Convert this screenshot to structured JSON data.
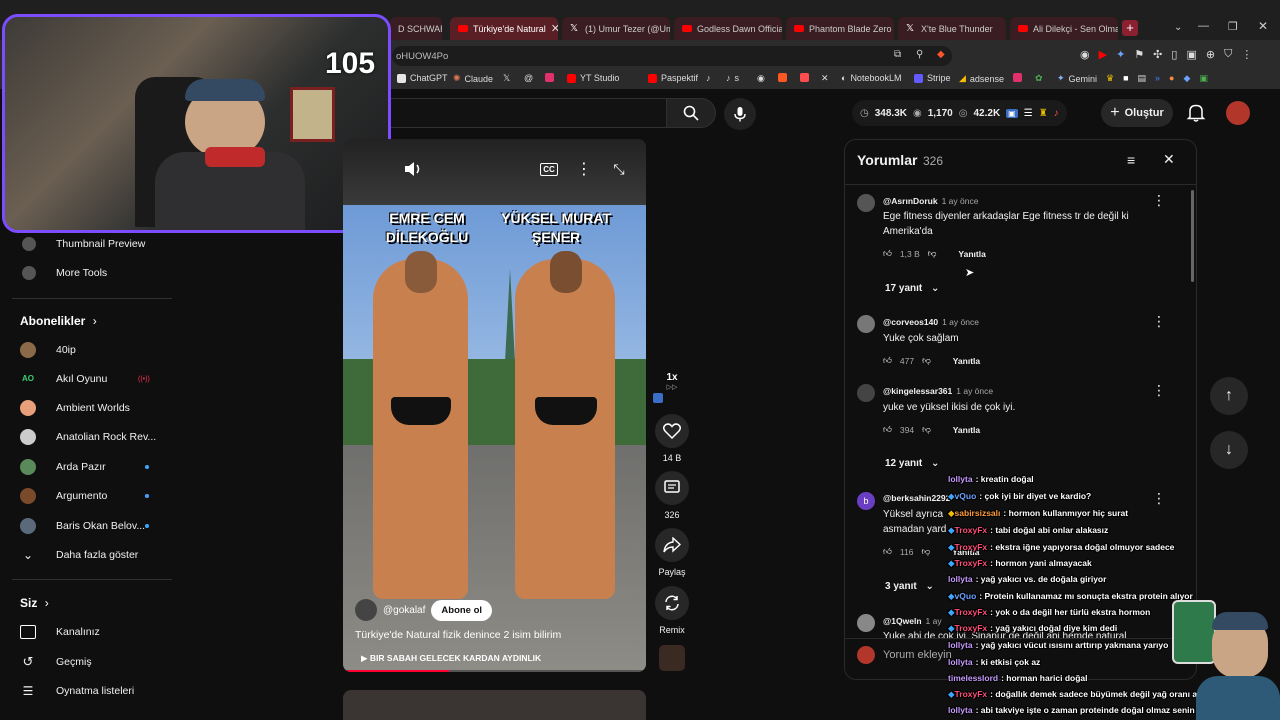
{
  "webcam": {
    "viewer_count": "105"
  },
  "tabs": [
    {
      "label": "D SCHWARZE",
      "icon": "none",
      "active": false
    },
    {
      "label": "Türkiye'de Natural",
      "icon": "youtube",
      "active": true
    },
    {
      "label": "(1) Umur Tezer (@Um",
      "icon": "x",
      "active": false
    },
    {
      "label": "Godless Dawn Officia",
      "icon": "youtube",
      "active": false
    },
    {
      "label": "Phantom Blade Zero",
      "icon": "youtube",
      "active": false
    },
    {
      "label": "X'te Blue Thunder",
      "icon": "x",
      "active": false
    },
    {
      "label": "Ali Dilekçi - Sen Olma",
      "icon": "youtube",
      "active": false
    }
  ],
  "address": {
    "url_fragment": "oHUOW4Po"
  },
  "bookmarks": [
    {
      "label": "ChatGPT",
      "color": "#e6e6e6"
    },
    {
      "label": "Claude",
      "color": "#d97757"
    },
    {
      "label": "",
      "color": "#ffffff"
    },
    {
      "label": "",
      "color": "#bbbbbb"
    },
    {
      "label": "",
      "color": "#e1306c"
    },
    {
      "label": "YT Studio",
      "color": "#ff0000"
    },
    {
      "label": "Paspektif",
      "color": "#ff0000"
    },
    {
      "label": "",
      "color": "#ffffff"
    },
    {
      "label": "s",
      "color": "#ffffff"
    },
    {
      "label": "",
      "color": "#ffffff"
    },
    {
      "label": "",
      "color": "#ff5722"
    },
    {
      "label": "",
      "color": "#ff4d4d"
    },
    {
      "label": "",
      "color": "#ffffff"
    },
    {
      "label": "NotebookLM",
      "color": "#ffffff"
    },
    {
      "label": "Stripe",
      "color": "#635bff"
    },
    {
      "label": "adsense",
      "color": "#fbbc04"
    },
    {
      "label": "",
      "color": "#e1306c"
    },
    {
      "label": "",
      "color": "#4caf50"
    },
    {
      "label": "Gemini",
      "color": "#8ab4f8"
    }
  ],
  "header": {
    "stats": {
      "views": "348.3K",
      "subs": "1,170",
      "watch": "42.2K"
    },
    "create_label": "Oluştur"
  },
  "sidebar": {
    "top_items": [
      {
        "label": "Thumbnail Preview"
      },
      {
        "label": "More Tools"
      }
    ],
    "subs_title": "Abonelikler",
    "subscriptions": [
      {
        "label": "40ip",
        "color": "#8b6a4a",
        "live": false,
        "badge": ""
      },
      {
        "label": "Akıl Oyunu",
        "color": "#0f0f0f",
        "live": true,
        "badge": "((•))",
        "logo_text": "AO"
      },
      {
        "label": "Ambient Worlds",
        "color": "#e8a07a",
        "live": false,
        "badge": ""
      },
      {
        "label": "Anatolian Rock Rev...",
        "color": "#cccccc",
        "live": false,
        "badge": ""
      },
      {
        "label": "Arda Pazır",
        "color": "#5a8a5a",
        "live": false,
        "badge": "•"
      },
      {
        "label": "Argumento",
        "color": "#7a4a2a",
        "live": false,
        "badge": "•"
      },
      {
        "label": "Baris Okan Belov...",
        "color": "#5a6a7a",
        "live": false,
        "badge": "•"
      }
    ],
    "show_more": "Daha fazla göster",
    "you_title": "Siz",
    "you_items": [
      {
        "label": "Kanalınız"
      },
      {
        "label": "Geçmiş"
      },
      {
        "label": "Oynatma listeleri"
      }
    ]
  },
  "video": {
    "overlay_name_1": "EMRE CEM DİLEKOĞLU",
    "overlay_name_2": "YÜKSEL MURAT ŞENER",
    "channel": "@gokalaf",
    "subscribe_label": "Abone ol",
    "title": "Türkiye'de Natural fizik denince 2 isim bilirim",
    "music": "BIR SABAH GELECEK KARDAN AYDINLIK",
    "progress": 0.35,
    "speed": "1x"
  },
  "actions": {
    "likes": "14 B",
    "comments": "326",
    "share": "Paylaş",
    "remix": "Remix"
  },
  "comments_panel": {
    "title": "Yorumlar",
    "count": "326",
    "input_placeholder": "Yorum ekleyin",
    "comments": [
      {
        "user": "@AsrınDoruk",
        "time": "1 ay önce",
        "text": "Ege fitness diyenler arkadaşlar Ege fitness tr de değil ki Amerika'da",
        "likes": "1,3 B",
        "reply": "Yanıtla",
        "replies": "17 yanıt",
        "avatar_color": "#555555"
      },
      {
        "user": "@corveos140",
        "time": "1 ay önce",
        "text": "Yuke çok sağlam",
        "likes": "477",
        "reply": "Yanıtla",
        "replies": "",
        "avatar_color": "#777777"
      },
      {
        "user": "@kingelessar361",
        "time": "1 ay önce",
        "text": "yuke ve yüksel ikisi de çok iyi.",
        "likes": "394",
        "reply": "Yanıtla",
        "replies": "12 yanıt",
        "avatar_color": "#444444"
      },
      {
        "user": "@berksahin2292",
        "time": "",
        "text": "Yüksel ayrıca",
        "text2": "asmadan yard",
        "likes": "116",
        "reply": "Yanıtla",
        "replies": "3 yanıt",
        "avatar_color": "#6a3ec2",
        "avatar_letter": "b"
      },
      {
        "user": "@1Qweln",
        "time": "1 ay",
        "text": "Yuke abi de çok iyi. Sinanur de değil abi hemde natural",
        "likes": "",
        "reply": "",
        "replies": "",
        "avatar_color": "#888888"
      }
    ]
  },
  "chat": [
    {
      "user": "lollyta",
      "user_color": "#c79bff",
      "text": "kreatin doğal"
    },
    {
      "user": "vQuo",
      "user_color": "#6ba3ff",
      "text": "çok iyi bir diyet ve kardio?"
    },
    {
      "user": "sabirsizsalı",
      "user_color": "#ff9a3c",
      "text": "hormon kullanmıyor"
    },
    {
      "user": "hiç surat",
      "user_color": "#ffffff",
      "text": ""
    },
    {
      "user": "TroxyFx",
      "user_color": "#ff4f7a",
      "text": "tabi doğal abi onlar alakasız"
    },
    {
      "user": "TroxyFx",
      "user_color": "#ff4f7a",
      "text": "ekstra iğne yapıyorsa doğal olmuyor sadece"
    },
    {
      "user": "TroxyFx",
      "user_color": "#ff4f7a",
      "text": "hormon yani almayacak"
    },
    {
      "user": "lollyta",
      "user_color": "#c79bff",
      "text": "yağ yakıcı vs. de doğala giriyor"
    },
    {
      "user": "vQuo",
      "user_color": "#6ba3ff",
      "text": "Protein kullanamaz mı sonuçta ekstra protein alıyor"
    },
    {
      "user": "TroxyFx",
      "user_color": "#ff4f7a",
      "text": "yok o da değil her türlü ekstra hormon"
    },
    {
      "user": "TroxyFx",
      "user_color": "#ff4f7a",
      "text": "yağ yakıcı doğal diye kim dedi"
    },
    {
      "user": "lollyta",
      "user_color": "#c79bff",
      "text": "yağ yakıcı vücut ısısını arttırıp yakmana yarıyo"
    },
    {
      "user": "lollyta",
      "user_color": "#c79bff",
      "text": "ki etkisi çok az"
    },
    {
      "user": "timelesslord",
      "user_color": "#c79bff",
      "text": "horman harici doğal"
    },
    {
      "user": "TroxyFx",
      "user_color": "#ff4f7a",
      "text": "doğallık demek sadece büyümek değil yağ oranı azalt"
    },
    {
      "user": "lollyta",
      "user_color": "#c79bff",
      "text": "abi takviye işte o zaman proteinde doğal olmaz senin mantığın"
    }
  ]
}
